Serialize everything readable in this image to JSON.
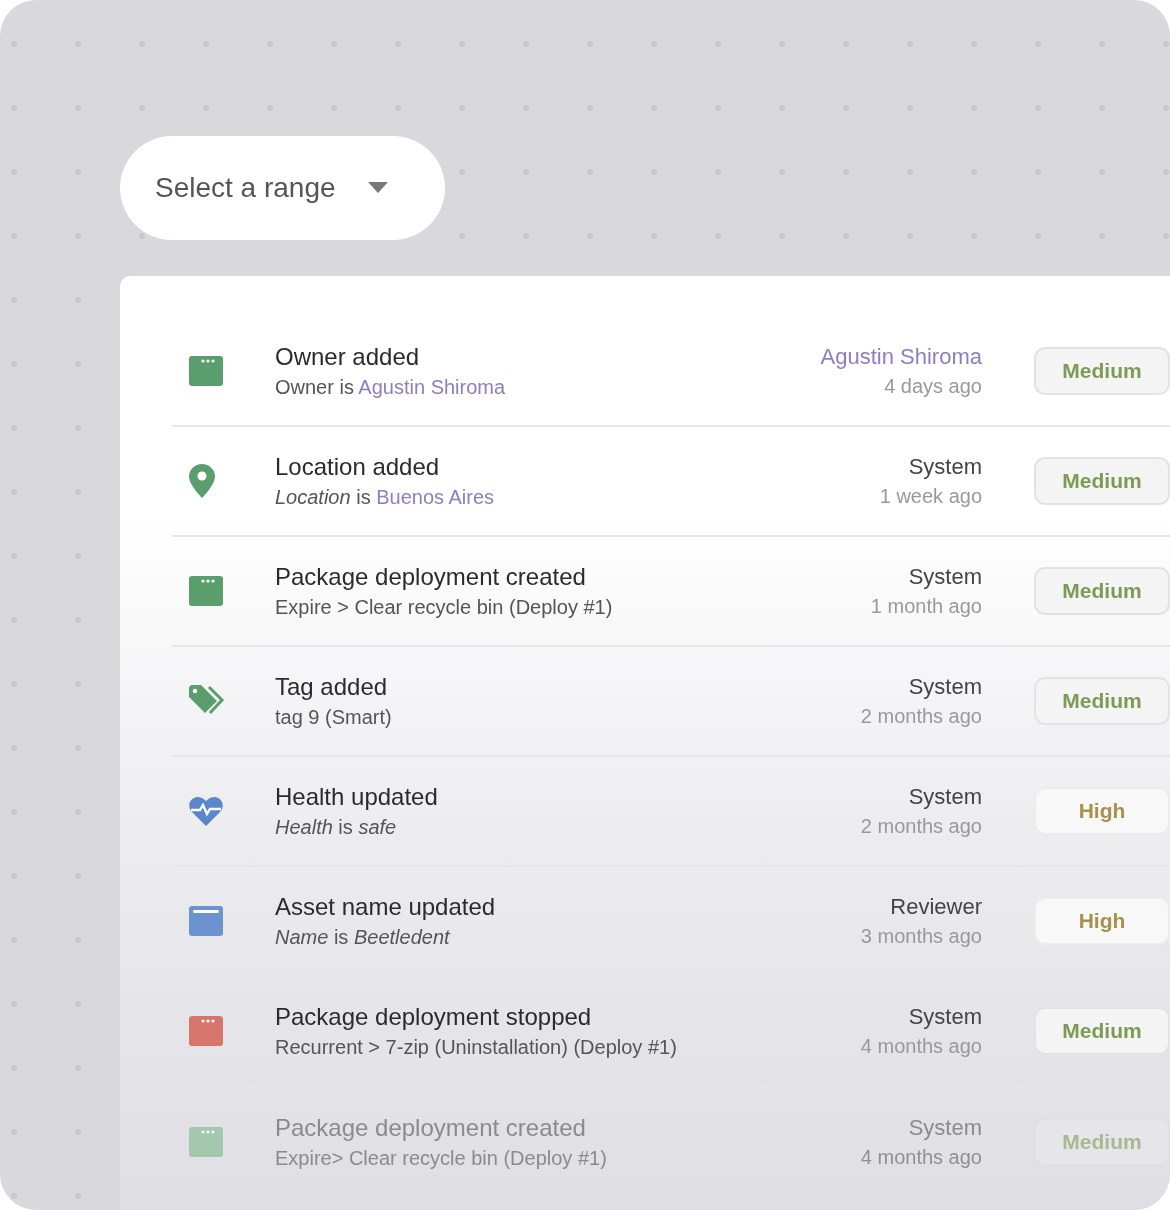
{
  "range_select": {
    "placeholder": "Select a range"
  },
  "events": [
    {
      "kind": "window",
      "color": "#5a9e6e",
      "title": "Owner added",
      "subtitle": [
        {
          "text": "Owner is ",
          "kind": "plain"
        },
        {
          "text": "Agustin Shiroma",
          "kind": "link"
        }
      ],
      "actor": {
        "text": "Agustin Shiroma",
        "kind": "link"
      },
      "time": "4 days ago",
      "priority": "Medium",
      "faded": false
    },
    {
      "kind": "pin",
      "color": "#5a9e6e",
      "title": "Location added",
      "subtitle": [
        {
          "text": "Location",
          "kind": "italic"
        },
        {
          "text": " is ",
          "kind": "plain"
        },
        {
          "text": "Buenos Aires",
          "kind": "link"
        }
      ],
      "actor": {
        "text": "System",
        "kind": "plain"
      },
      "time": "1 week ago",
      "priority": "Medium",
      "faded": false
    },
    {
      "kind": "window",
      "color": "#5a9e6e",
      "title": "Package deployment created",
      "subtitle": [
        {
          "text": "Expire > Clear recycle bin (Deploy #1)",
          "kind": "plain"
        }
      ],
      "actor": {
        "text": "System",
        "kind": "plain"
      },
      "time": "1 month ago",
      "priority": "Medium",
      "faded": false
    },
    {
      "kind": "tag",
      "color": "#5a9e6e",
      "title": "Tag added",
      "subtitle": [
        {
          "text": "tag 9 (Smart)",
          "kind": "plain"
        }
      ],
      "actor": {
        "text": "System",
        "kind": "plain"
      },
      "time": "2 months ago",
      "priority": "Medium",
      "faded": false
    },
    {
      "kind": "heart",
      "color": "#5b86c9",
      "title": "Health updated",
      "subtitle": [
        {
          "text": "Health",
          "kind": "italic"
        },
        {
          "text": " is ",
          "kind": "plain"
        },
        {
          "text": "safe",
          "kind": "italic"
        }
      ],
      "actor": {
        "text": "System",
        "kind": "plain"
      },
      "time": "2 months ago",
      "priority": "High",
      "faded": false
    },
    {
      "kind": "browser",
      "color": "#6c93cf",
      "title": "Asset name updated",
      "subtitle": [
        {
          "text": "Name",
          "kind": "italic"
        },
        {
          "text": " is ",
          "kind": "plain"
        },
        {
          "text": "Beetledent",
          "kind": "italic"
        }
      ],
      "actor": {
        "text": "Reviewer",
        "kind": "plain"
      },
      "time": "3 months ago",
      "priority": "High",
      "faded": false
    },
    {
      "kind": "window",
      "color": "#d6756b",
      "title": "Package deployment stopped",
      "subtitle": [
        {
          "text": "Recurrent > 7-zip (Uninstallation) (Deploy #1)",
          "kind": "plain"
        }
      ],
      "actor": {
        "text": "System",
        "kind": "plain"
      },
      "time": "4 months ago",
      "priority": "Medium",
      "faded": false
    },
    {
      "kind": "window",
      "color": "#a3c8ae",
      "title": "Package deployment created",
      "subtitle": [
        {
          "text": "Expire> Clear recycle bin (Deploy #1)",
          "kind": "plain"
        }
      ],
      "actor": {
        "text": "System",
        "kind": "plain"
      },
      "time": "4 months ago",
      "priority": "Medium",
      "faded": true
    }
  ]
}
